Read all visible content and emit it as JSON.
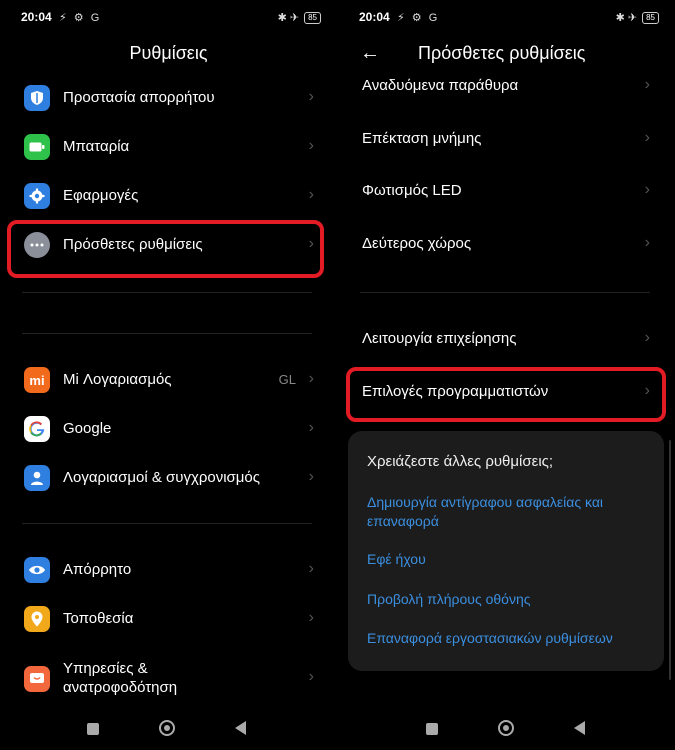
{
  "status": {
    "time": "20:04",
    "left_icons": "⚡︎ ⚙ G",
    "right_icons": "✱ ✈",
    "battery": "85"
  },
  "left": {
    "title": "Ρυθμίσεις",
    "group1": [
      {
        "label": "Προστασία απορρήτου",
        "icon": "shield-icon",
        "color": "#2f7fe0"
      },
      {
        "label": "Μπαταρία",
        "icon": "battery-icon",
        "color": "#2ec24a"
      },
      {
        "label": "Εφαρμογές",
        "icon": "gear-icon",
        "color": "#2f7fe0"
      },
      {
        "label": "Πρόσθετες ρυθμίσεις",
        "icon": "more-dots-icon",
        "color": "#8a8f99"
      }
    ],
    "group2": [
      {
        "label": "Mi Λογαριασμός",
        "icon": "mi-logo-icon",
        "color": "#f26a1b",
        "extra": "GL"
      },
      {
        "label": "Google",
        "icon": "google-icon",
        "color": "#ffffff"
      },
      {
        "label": "Λογαριασμοί & συγχρονισμός",
        "icon": "user-icon",
        "color": "#2f7fe0"
      }
    ],
    "group3": [
      {
        "label": "Απόρρητο",
        "icon": "eye-icon",
        "color": "#2f7fe0"
      },
      {
        "label": "Τοποθεσία",
        "icon": "location-pin-icon",
        "color": "#f2a81b"
      },
      {
        "label": "Υπηρεσίες & ανατροφοδότηση",
        "icon": "feedback-icon",
        "color": "#f2673b"
      }
    ]
  },
  "right": {
    "title": "Πρόσθετες ρυθμίσεις",
    "group1": [
      {
        "label": "Αναδυόμενα παράθυρα"
      },
      {
        "label": "Επέκταση μνήμης"
      },
      {
        "label": "Φωτισμός LED"
      },
      {
        "label": "Δεύτερος χώρος"
      }
    ],
    "group2": [
      {
        "label": "Λειτουργία επιχείρησης"
      },
      {
        "label": "Επιλογές προγραμματιστών"
      }
    ],
    "card": {
      "question": "Χρειάζεστε άλλες ρυθμίσεις;",
      "links": [
        "Δημιουργία αντίγραφου ασφαλείας και επαναφορά",
        "Εφέ ήχου",
        "Προβολή πλήρους οθόνης",
        "Επαναφορά εργοστασιακών ρυθμίσεων"
      ]
    }
  },
  "colors": {
    "highlight": "#e21b24",
    "link": "#3b8fe0"
  }
}
